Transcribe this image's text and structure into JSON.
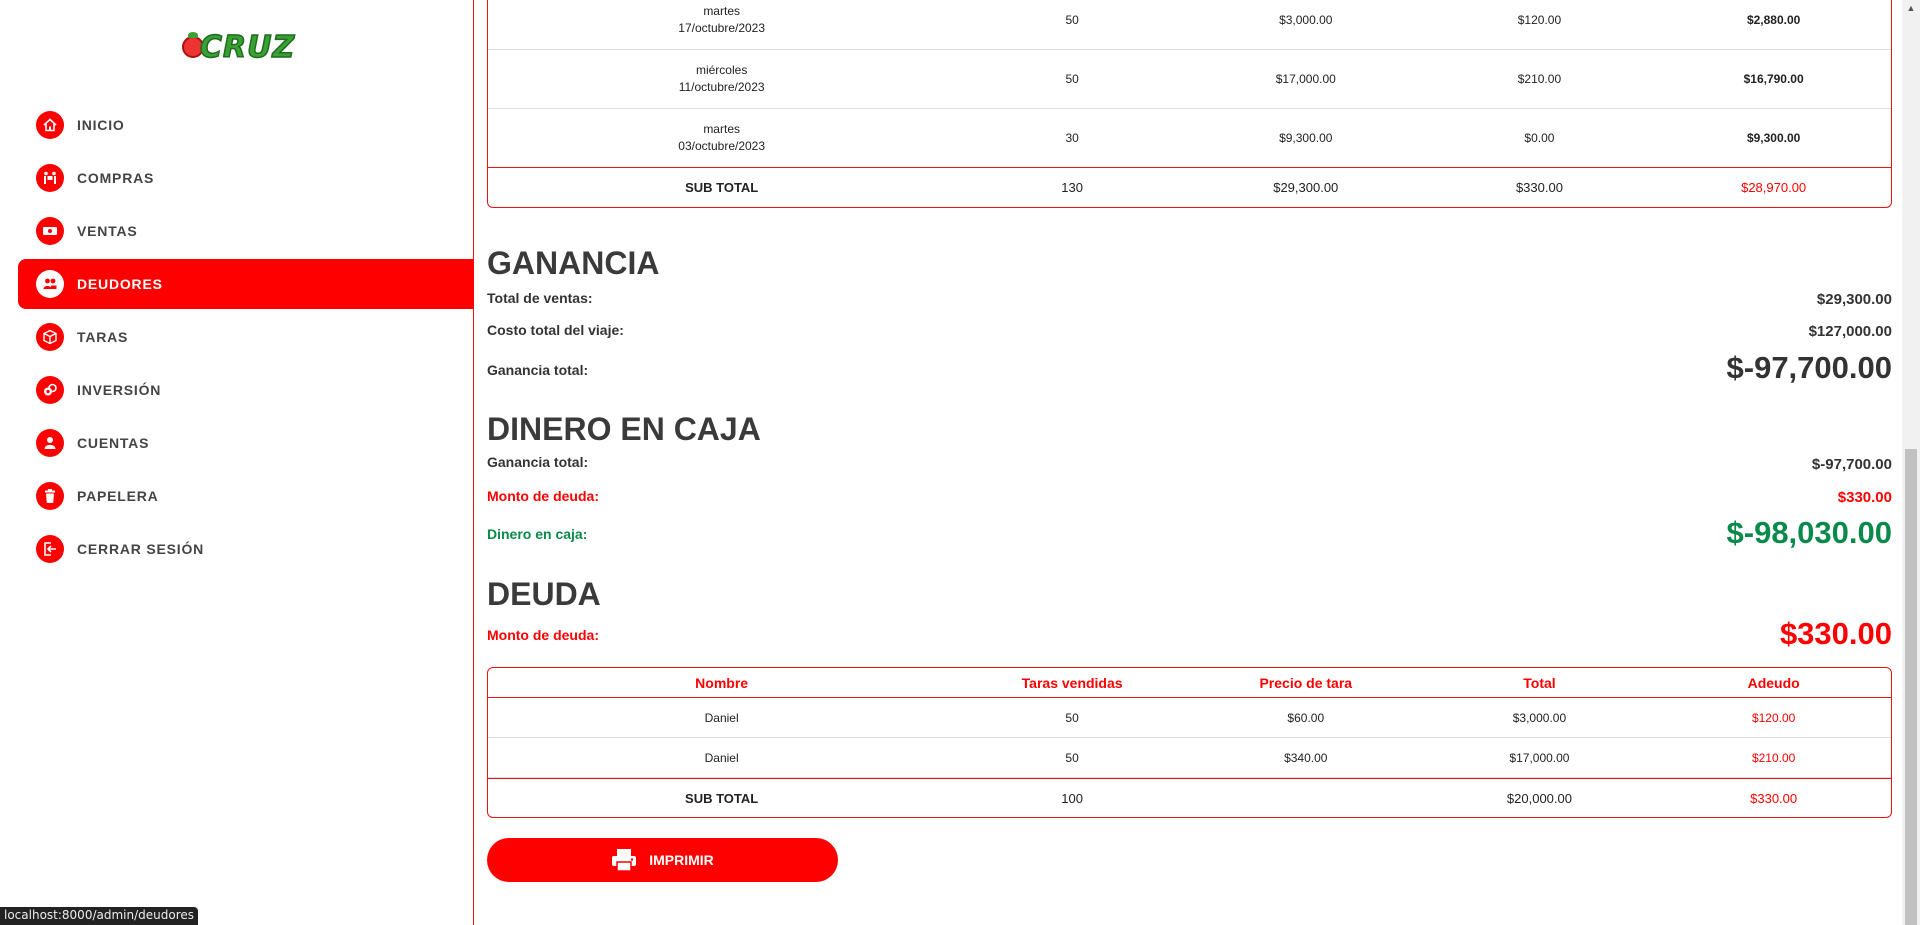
{
  "brand": {
    "logo_text": "CRUZ"
  },
  "nav": [
    {
      "label": "INICIO",
      "icon": "home-icon",
      "active": false
    },
    {
      "label": "COMPRAS",
      "icon": "people-carry-icon",
      "active": false
    },
    {
      "label": "VENTAS",
      "icon": "money-bill-icon",
      "active": false
    },
    {
      "label": "DEUDORES",
      "icon": "users-icon",
      "active": true
    },
    {
      "label": "TARAS",
      "icon": "box-icon",
      "active": false
    },
    {
      "label": "INVERSIÓN",
      "icon": "coins-icon",
      "active": false
    },
    {
      "label": "CUENTAS",
      "icon": "user-icon",
      "active": false
    },
    {
      "label": "PAPELERA",
      "icon": "trash-icon",
      "active": false
    },
    {
      "label": "CERRAR SESIÓN",
      "icon": "logout-icon",
      "active": false
    }
  ],
  "sales_table": {
    "rows": [
      {
        "day": "martes",
        "date": "17/octubre/2023",
        "taras": "50",
        "total": "$3,000.00",
        "debt": "$120.00",
        "net": "$2,880.00"
      },
      {
        "day": "miércoles",
        "date": "11/octubre/2023",
        "taras": "50",
        "total": "$17,000.00",
        "debt": "$210.00",
        "net": "$16,790.00"
      },
      {
        "day": "martes",
        "date": "03/octubre/2023",
        "taras": "30",
        "total": "$9,300.00",
        "debt": "$0.00",
        "net": "$9,300.00"
      }
    ],
    "subtotal": {
      "label": "SUB TOTAL",
      "taras": "130",
      "total": "$29,300.00",
      "debt": "$330.00",
      "net": "$28,970.00"
    }
  },
  "ganancia": {
    "title": "GANANCIA",
    "total_ventas_label": "Total de ventas:",
    "total_ventas": "$29,300.00",
    "costo_viaje_label": "Costo total del viaje:",
    "costo_viaje": "$127,000.00",
    "ganancia_total_label": "Ganancia total:",
    "ganancia_total": "$-97,700.00"
  },
  "caja": {
    "title": "DINERO EN CAJA",
    "ganancia_label": "Ganancia total:",
    "ganancia": "$-97,700.00",
    "deuda_label": "Monto de deuda:",
    "deuda": "$330.00",
    "dinero_label": "Dinero en caja:",
    "dinero": "$-98,030.00"
  },
  "deuda": {
    "title": "DEUDA",
    "monto_label": "Monto de deuda:",
    "monto": "$330.00"
  },
  "debt_table": {
    "headers": [
      "Nombre",
      "Taras vendidas",
      "Precio de tara",
      "Total",
      "Adeudo"
    ],
    "rows": [
      {
        "name": "Daniel",
        "taras": "50",
        "price": "$60.00",
        "total": "$3,000.00",
        "owed": "$120.00"
      },
      {
        "name": "Daniel",
        "taras": "50",
        "price": "$340.00",
        "total": "$17,000.00",
        "owed": "$210.00"
      }
    ],
    "subtotal": {
      "label": "SUB TOTAL",
      "taras": "100",
      "price": "",
      "total": "$20,000.00",
      "owed": "$330.00"
    }
  },
  "print_button": {
    "label": "IMPRIMIR",
    "icon": "printer-icon"
  },
  "status_bar": {
    "url": "localhost:8000/admin/deudores"
  },
  "colors": {
    "accent": "#ff0000",
    "positive": "#0a8a4a",
    "text": "#333333"
  }
}
